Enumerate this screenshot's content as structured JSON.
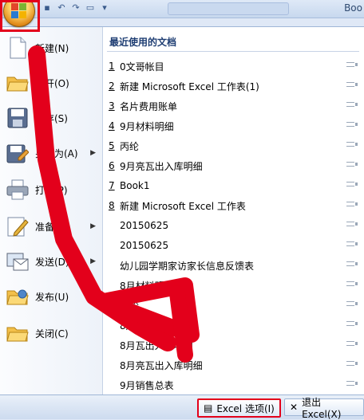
{
  "window": {
    "title": "Boo"
  },
  "menu": {
    "commands": [
      {
        "label": "新建(N)",
        "icon": "new-document-icon",
        "has_arrow": false
      },
      {
        "label": "打开(O)",
        "icon": "open-folder-icon",
        "has_arrow": false
      },
      {
        "label": "保存(S)",
        "icon": "save-disk-icon",
        "has_arrow": false
      },
      {
        "label": "另存为(A)",
        "icon": "save-as-icon",
        "has_arrow": true
      },
      {
        "label": "打印(P)",
        "icon": "printer-icon",
        "has_arrow": true
      },
      {
        "label": "准备(E)",
        "icon": "prepare-pen-icon",
        "has_arrow": true
      },
      {
        "label": "发送(D)",
        "icon": "send-icon",
        "has_arrow": true
      },
      {
        "label": "发布(U)",
        "icon": "publish-folder-icon",
        "has_arrow": true
      },
      {
        "label": "关闭(C)",
        "icon": "close-folder-icon",
        "has_arrow": false
      }
    ],
    "recent": {
      "heading": "最近使用的文档",
      "items": [
        {
          "num": "1",
          "name": "0文哥帐目"
        },
        {
          "num": "2",
          "name": "新建 Microsoft Excel 工作表(1)"
        },
        {
          "num": "3",
          "name": "名片费用账单"
        },
        {
          "num": "4",
          "name": "9月材料明细"
        },
        {
          "num": "5",
          "name": "丙纶"
        },
        {
          "num": "6",
          "name": "9月亮瓦出入库明细"
        },
        {
          "num": "7",
          "name": "Book1"
        },
        {
          "num": "8",
          "name": "新建 Microsoft Excel 工作表"
        },
        {
          "num": "",
          "name": "20150625"
        },
        {
          "num": "",
          "name": "20150625"
        },
        {
          "num": "",
          "name": "幼儿园学期家访家长信息反馈表"
        },
        {
          "num": "",
          "name": "8月材料明细"
        },
        {
          "num": "",
          "name": "丙纶"
        },
        {
          "num": "",
          "name": "8月销售总表"
        },
        {
          "num": "",
          "name": "8月瓦出入库明细"
        },
        {
          "num": "",
          "name": "8月亮瓦出入库明细"
        },
        {
          "num": "",
          "name": "9月销售总表"
        }
      ]
    }
  },
  "bottom": {
    "options_label": "Excel 选项(I)",
    "exit_label": "退出 Excel(X)"
  },
  "colors": {
    "annotation_red": "#e3001b",
    "menu_bg": "#ffffff",
    "ribbon_blue": "#dfe8f6"
  }
}
